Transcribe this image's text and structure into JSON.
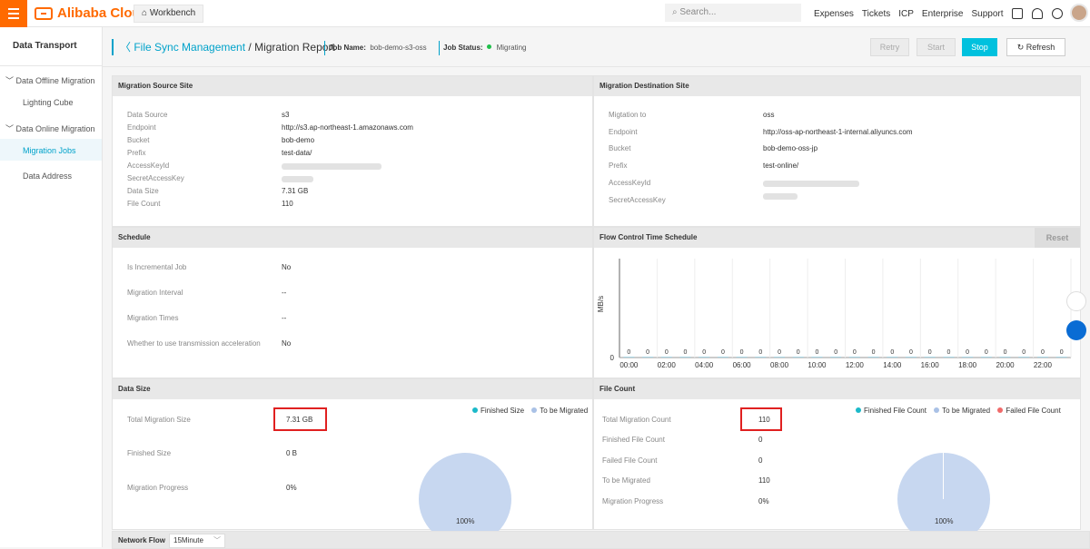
{
  "topbar": {
    "brand": "Alibaba Cloud",
    "workbench": "Workbench",
    "search_placeholder": "Search...",
    "nav": [
      "Expenses",
      "Tickets",
      "ICP",
      "Enterprise",
      "Support"
    ],
    "lang": "EN",
    "accent": "#ff6a00"
  },
  "sidebar": {
    "title": "Data Transport",
    "items": [
      {
        "label": "Data Offline Migration",
        "type": "group"
      },
      {
        "label": "Lighting Cube",
        "type": "item"
      },
      {
        "label": "Data Online Migration",
        "type": "group"
      },
      {
        "label": "Migration Jobs",
        "type": "item",
        "active": true
      },
      {
        "label": "Data Address",
        "type": "item"
      }
    ]
  },
  "header": {
    "breadcrumb_link": "File Sync Management",
    "breadcrumb_current": " / Migration Report",
    "job_name_label": "Job Name:",
    "job_name": "bob-demo-s3-oss",
    "job_status_label": "Job Status:",
    "job_status": "Migrating",
    "buttons": {
      "retry": "Retry",
      "start": "Start",
      "stop": "Stop",
      "refresh": "Refresh"
    }
  },
  "source": {
    "title": "Migration Source Site",
    "rows": [
      {
        "label": "Data Source",
        "value": "s3"
      },
      {
        "label": "Endpoint",
        "value": "http://s3.ap-northeast-1.amazonaws.com"
      },
      {
        "label": "Bucket",
        "value": "bob-demo"
      },
      {
        "label": "Prefix",
        "value": "test-data/"
      },
      {
        "label": "AccessKeyId",
        "value": ""
      },
      {
        "label": "SecretAccessKey",
        "value": ""
      },
      {
        "label": "Data Size",
        "value": "7.31 GB"
      },
      {
        "label": "File Count",
        "value": "110"
      }
    ]
  },
  "destination": {
    "title": "Migration Destination Site",
    "rows": [
      {
        "label": "Migtation to",
        "value": "oss"
      },
      {
        "label": "Endpoint",
        "value": "http://oss-ap-northeast-1-internal.aliyuncs.com"
      },
      {
        "label": "Bucket",
        "value": "bob-demo-oss-jp"
      },
      {
        "label": "Prefix",
        "value": "test-online/"
      },
      {
        "label": "AccessKeyId",
        "value": ""
      },
      {
        "label": "SecretAccessKey",
        "value": ""
      }
    ]
  },
  "schedule": {
    "title": "Schedule",
    "rows": [
      {
        "label": "Is Incremental Job",
        "value": "No"
      },
      {
        "label": "Migration Interval",
        "value": "--"
      },
      {
        "label": "Migration Times",
        "value": "--"
      },
      {
        "label": "Whether to use transmission acceleration",
        "value": "No"
      }
    ]
  },
  "flow": {
    "title": "Flow Control Time Schedule",
    "reset": "Reset",
    "ylabel": "MB/s",
    "y_zero": "0"
  },
  "chart_data": {
    "type": "bar",
    "title": "Flow Control Time Schedule",
    "ylabel": "MB/s",
    "categories": [
      "00:00",
      "01:00",
      "02:00",
      "03:00",
      "04:00",
      "05:00",
      "06:00",
      "07:00",
      "08:00",
      "09:00",
      "10:00",
      "11:00",
      "12:00",
      "13:00",
      "14:00",
      "15:00",
      "16:00",
      "17:00",
      "18:00",
      "19:00",
      "20:00",
      "21:00",
      "22:00",
      "23:00"
    ],
    "values": [
      0,
      0,
      0,
      0,
      0,
      0,
      0,
      0,
      0,
      0,
      0,
      0,
      0,
      0,
      0,
      0,
      0,
      0,
      0,
      0,
      0,
      0,
      0,
      0
    ],
    "tick_labels": [
      "00:00",
      "02:00",
      "04:00",
      "06:00",
      "08:00",
      "10:00",
      "12:00",
      "14:00",
      "16:00",
      "18:00",
      "20:00",
      "22:00"
    ],
    "grid": true
  },
  "datasize": {
    "title": "Data Size",
    "rows": [
      {
        "label": "Total Migration Size",
        "value": "7.31 GB"
      },
      {
        "label": "Finished Size",
        "value": "0 B"
      },
      {
        "label": "Migration Progress",
        "value": "0%"
      }
    ],
    "legend": [
      {
        "label": "Finished Size",
        "color": "#1bb9c9"
      },
      {
        "label": "To be Migrated",
        "color": "#a9c1e6"
      }
    ],
    "pie_label": "100%"
  },
  "filecount": {
    "title": "File Count",
    "rows": [
      {
        "label": "Total Migration Count",
        "value": "110"
      },
      {
        "label": "Finished File Count",
        "value": "0"
      },
      {
        "label": "Failed File Count",
        "value": "0"
      },
      {
        "label": "To be Migrated",
        "value": "110"
      },
      {
        "label": "Migration Progress",
        "value": "0%"
      }
    ],
    "legend": [
      {
        "label": "Finished File Count",
        "color": "#1bb9c9"
      },
      {
        "label": "To be Migrated",
        "color": "#a9c1e6"
      },
      {
        "label": "Failed File Count",
        "color": "#f06a6a"
      }
    ],
    "pie_label": "100%"
  },
  "network": {
    "title": "Network Flow",
    "interval": "15Minute"
  }
}
